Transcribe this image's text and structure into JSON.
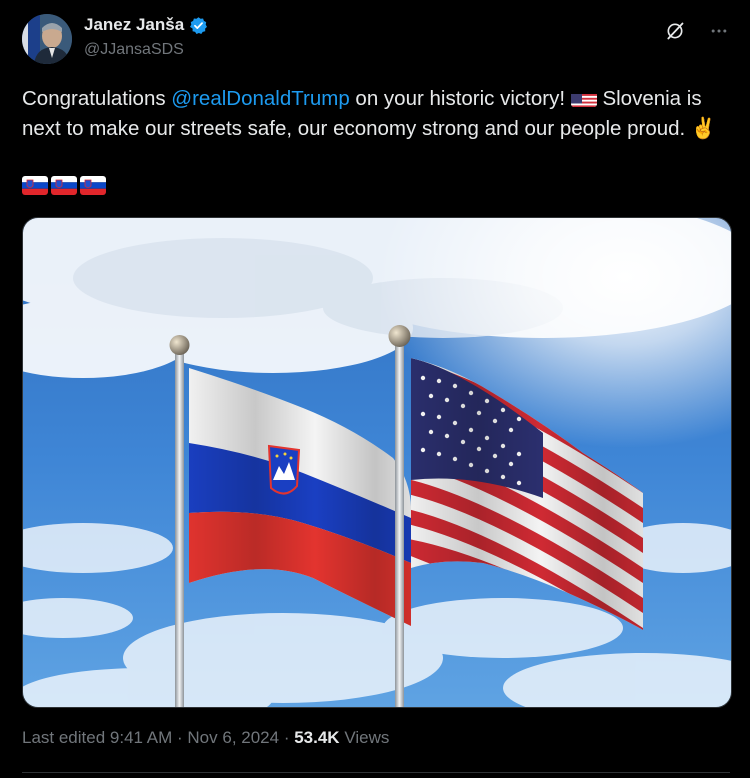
{
  "author": {
    "display_name": "Janez Janša",
    "handle": "@JJansaSDS",
    "verified_badge_icon": "verified-badge-icon"
  },
  "toolbar": {
    "grok_icon": "grok-icon",
    "more_icon": "more-icon"
  },
  "tweet": {
    "text_part1": "Congratulations ",
    "mention": "@realDonaldTrump",
    "text_part2": " on your historic victory! ",
    "text_part3": " Slovenia is next to make our streets safe, our economy strong and our people proud. ",
    "peace_emoji": "✌️",
    "us_flag_emoji": "us-flag-emoji",
    "si_flag_emoji": "slovenia-flag-emoji",
    "si_flag_count": 3
  },
  "media": {
    "description_icon": "slovenia-and-us-flags-photo"
  },
  "meta": {
    "edited_label": "Last edited",
    "time": "9:41 AM",
    "separator": " · ",
    "date": "Nov 6, 2024",
    "views_count": "53.4K",
    "views_label": "Views"
  },
  "colors": {
    "background": "#000000",
    "text": "#e7e9ea",
    "secondary": "#71767b",
    "link": "#1d9bf0"
  }
}
